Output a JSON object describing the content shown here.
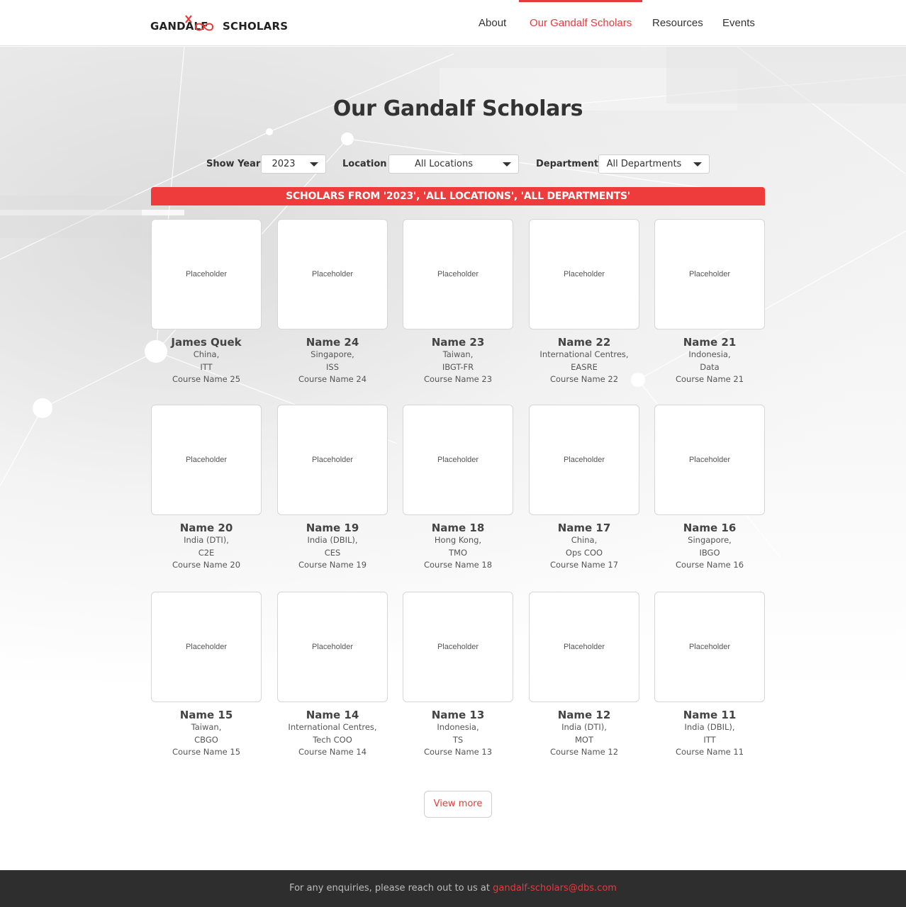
{
  "header": {
    "logo_left": "GANDALF",
    "logo_right": "SCHOLARS",
    "nav": [
      {
        "label": "About",
        "active": false
      },
      {
        "label": "Our Gandalf Scholars",
        "active": true
      },
      {
        "label": "Resources",
        "active": false
      },
      {
        "label": "Events",
        "active": false
      }
    ]
  },
  "main": {
    "title": "Our Gandalf Scholars",
    "filters": {
      "year_label": "Show Year",
      "year_value": "2023",
      "location_label": "Location",
      "location_value": "All Locations",
      "department_label": "Department",
      "department_value": "All Departments"
    },
    "banner": "SCHOLARS FROM '2023', 'ALL LOCATIONS', 'ALL DEPARTMENTS'",
    "scholars": [
      {
        "photo": "Placeholder",
        "name": "James Quek",
        "location": "China,",
        "department": "ITT",
        "course": "Course Name 25"
      },
      {
        "photo": "Placeholder",
        "name": "Name 24",
        "location": "Singapore,",
        "department": "ISS",
        "course": "Course Name 24"
      },
      {
        "photo": "Placeholder",
        "name": "Name 23",
        "location": "Taiwan,",
        "department": "IBGT-FR",
        "course": "Course Name 23"
      },
      {
        "photo": "Placeholder",
        "name": "Name 22",
        "location": "International Centres,",
        "department": "EASRE",
        "course": "Course Name 22"
      },
      {
        "photo": "Placeholder",
        "name": "Name 21",
        "location": "Indonesia,",
        "department": "Data",
        "course": "Course Name 21"
      },
      {
        "photo": "Placeholder",
        "name": "Name 20",
        "location": "India (DTI),",
        "department": "C2E",
        "course": "Course Name 20"
      },
      {
        "photo": "Placeholder",
        "name": "Name 19",
        "location": "India (DBIL),",
        "department": "CES",
        "course": "Course Name 19"
      },
      {
        "photo": "Placeholder",
        "name": "Name 18",
        "location": "Hong Kong,",
        "department": "TMO",
        "course": "Course Name 18"
      },
      {
        "photo": "Placeholder",
        "name": "Name 17",
        "location": "China,",
        "department": "Ops COO",
        "course": "Course Name 17"
      },
      {
        "photo": "Placeholder",
        "name": "Name 16",
        "location": "Singapore,",
        "department": "IBGO",
        "course": "Course Name 16"
      },
      {
        "photo": "Placeholder",
        "name": "Name 15",
        "location": "Taiwan,",
        "department": "CBGO",
        "course": "Course Name 15"
      },
      {
        "photo": "Placeholder",
        "name": "Name 14",
        "location": "International Centres,",
        "department": "Tech COO",
        "course": "Course Name 14"
      },
      {
        "photo": "Placeholder",
        "name": "Name 13",
        "location": "Indonesia,",
        "department": "TS",
        "course": "Course Name 13"
      },
      {
        "photo": "Placeholder",
        "name": "Name 12",
        "location": "India (DTI),",
        "department": "MOT",
        "course": "Course Name 12"
      },
      {
        "photo": "Placeholder",
        "name": "Name 11",
        "location": "India (DBIL),",
        "department": "ITT",
        "course": "Course Name 11"
      }
    ],
    "view_more": "View more"
  },
  "footer": {
    "text": "For any enquiries, please reach out to us at",
    "email": "gandalf-scholars@dbs.com"
  },
  "colors": {
    "accent": "#e83a3c",
    "footer_bg": "#2e2e2e"
  }
}
